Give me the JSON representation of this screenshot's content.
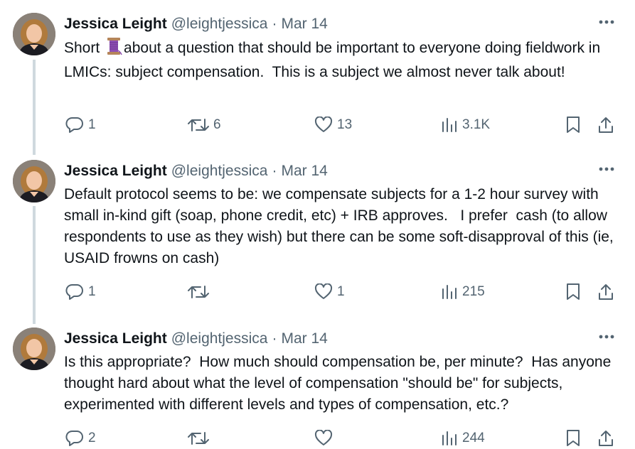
{
  "tweets": [
    {
      "author": {
        "name": "Jessica Leight",
        "handle": "@leightjessica"
      },
      "separator": "·",
      "date": "Mar 14",
      "text_before_emoji": "Short ",
      "text_after_emoji": "about a question that should be important to everyone doing fieldwork in LMICs: subject compensation.  This is a subject we almost never talk about!",
      "emoji_icon": "thread-spool-icon",
      "stats": {
        "replies": "1",
        "retweets": "6",
        "likes": "13",
        "views": "3.1K"
      }
    },
    {
      "author": {
        "name": "Jessica Leight",
        "handle": "@leightjessica"
      },
      "separator": "·",
      "date": "Mar 14",
      "text": "Default protocol seems to be: we compensate subjects for a 1-2 hour survey with small in-kind gift (soap, phone credit, etc) + IRB approves.   I prefer  cash (to allow respondents to use as they wish) but there can be some soft-disapproval of this (ie, USAID frowns on cash)",
      "stats": {
        "replies": "1",
        "retweets": "",
        "likes": "1",
        "views": "215"
      }
    },
    {
      "author": {
        "name": "Jessica Leight",
        "handle": "@leightjessica"
      },
      "separator": "·",
      "date": "Mar 14",
      "text": "Is this appropriate?  How much should compensation be, per minute?  Has anyone thought hard about what the level of compensation \"should be\" for subjects, experimented with different levels and types of compensation, etc.?",
      "stats": {
        "replies": "2",
        "retweets": "",
        "likes": "",
        "views": "244"
      }
    }
  ],
  "icons": {
    "more": "more-icon",
    "reply": "reply-icon",
    "retweet": "retweet-icon",
    "like": "heart-icon",
    "views": "views-icon",
    "bookmark": "bookmark-icon",
    "share": "share-icon"
  },
  "colors": {
    "text": "#0f1419",
    "muted": "#536471",
    "thread_line": "#cfd9de"
  }
}
